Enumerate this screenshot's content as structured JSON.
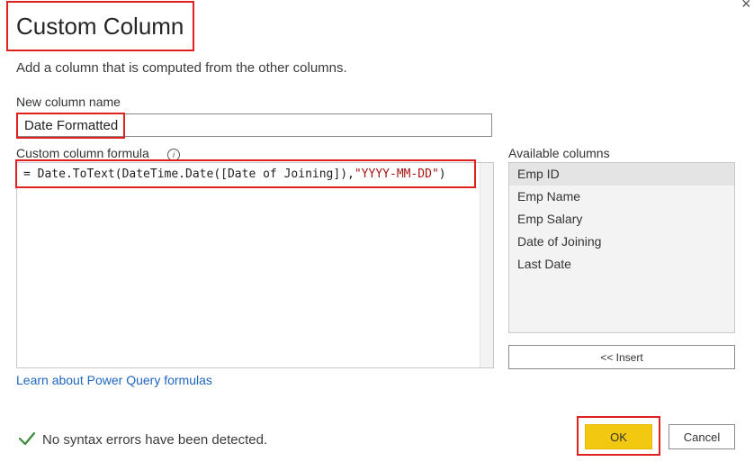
{
  "dialog": {
    "title": "Custom Column",
    "subtitle": "Add a column that is computed from the other columns.",
    "close_icon": "close-icon"
  },
  "new_column": {
    "label": "New column name",
    "value": "Date Formatted"
  },
  "formula": {
    "label": "Custom column formula",
    "info_icon": "info-icon",
    "code_prefix": "= Date.ToText(DateTime.Date([Date of Joining]),",
    "code_string": "\"YYYY-MM-DD\"",
    "code_suffix": ")"
  },
  "available_columns": {
    "label": "Available columns",
    "items": [
      "Emp ID",
      "Emp Name",
      "Emp Salary",
      "Date of Joining",
      "Last Date"
    ],
    "selected": "Emp ID"
  },
  "insert_button": "<< Insert",
  "learn_link": "Learn about Power Query formulas",
  "status": {
    "icon": "checkmark-icon",
    "text": "No syntax errors have been detected."
  },
  "buttons": {
    "ok": "OK",
    "cancel": "Cancel"
  },
  "colors": {
    "highlight_border": "#e0201f",
    "ok_button": "#f2c811",
    "link": "#1f66c1",
    "string_literal": "#a31515",
    "check": "#3a8a3a"
  }
}
